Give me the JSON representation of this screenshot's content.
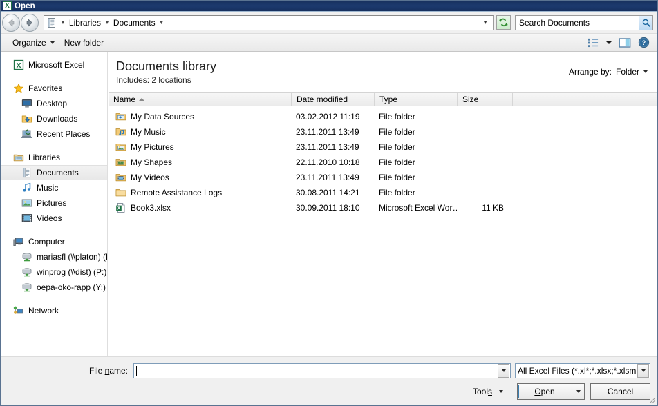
{
  "window": {
    "title": "Open",
    "icon": "excel-icon"
  },
  "navigation": {
    "back_label": "Back",
    "forward_label": "Forward",
    "address": {
      "icon": "library-document-icon",
      "crumbs": [
        "Libraries",
        "Documents"
      ],
      "dropdown_icon": "chevron-down-icon"
    },
    "refresh_icon": "refresh-icon",
    "search": {
      "placeholder": "Search Documents",
      "value": "",
      "icon": "search-icon"
    }
  },
  "toolbar": {
    "organize_label": "Organize",
    "new_folder_label": "New folder",
    "views_icon": "list-view-icon",
    "views_caret_icon": "chevron-down-icon",
    "preview_pane_icon": "preview-pane-icon",
    "help_icon": "help-icon"
  },
  "sidebar": {
    "items": [
      {
        "label": "Microsoft Excel",
        "icon": "excel-icon",
        "level": 0,
        "selected": false,
        "gap_after": true
      },
      {
        "label": "Favorites",
        "icon": "star-icon",
        "level": 0,
        "selected": false
      },
      {
        "label": "Desktop",
        "icon": "desktop-icon",
        "level": 1,
        "selected": false
      },
      {
        "label": "Downloads",
        "icon": "downloads-folder-icon",
        "level": 1,
        "selected": false
      },
      {
        "label": "Recent Places",
        "icon": "recent-places-icon",
        "level": 1,
        "selected": false,
        "gap_after": true
      },
      {
        "label": "Libraries",
        "icon": "libraries-icon",
        "level": 0,
        "selected": false
      },
      {
        "label": "Documents",
        "icon": "documents-library-icon",
        "level": 1,
        "selected": true
      },
      {
        "label": "Music",
        "icon": "music-library-icon",
        "level": 1,
        "selected": false
      },
      {
        "label": "Pictures",
        "icon": "pictures-library-icon",
        "level": 1,
        "selected": false
      },
      {
        "label": "Videos",
        "icon": "videos-library-icon",
        "level": 1,
        "selected": false,
        "gap_after": true
      },
      {
        "label": "Computer",
        "icon": "computer-icon",
        "level": 0,
        "selected": false
      },
      {
        "label": "mariasfl (\\\\platon) (M:)",
        "icon": "network-drive-icon",
        "level": 1,
        "selected": false
      },
      {
        "label": "winprog (\\\\dist) (P:)",
        "icon": "network-drive-icon",
        "level": 1,
        "selected": false
      },
      {
        "label": "oepa-oko-rapp (Y:)",
        "icon": "network-drive-icon",
        "level": 1,
        "selected": false,
        "gap_after": true
      },
      {
        "label": "Network",
        "icon": "network-icon",
        "level": 0,
        "selected": false
      }
    ]
  },
  "main": {
    "library_title": "Documents library",
    "library_subtitle": "Includes:  2 locations",
    "arrange_by_label": "Arrange by:",
    "arrange_by_value": "Folder",
    "arrange_caret_icon": "chevron-down-icon",
    "columns": [
      {
        "label": "Name",
        "sorted": "asc"
      },
      {
        "label": "Date modified",
        "sorted": ""
      },
      {
        "label": "Type",
        "sorted": ""
      },
      {
        "label": "Size",
        "sorted": ""
      }
    ],
    "rows": [
      {
        "name": "My Data Sources",
        "date": "03.02.2012 11:19",
        "type": "File folder",
        "size": "",
        "icon": "data-sources-folder-icon"
      },
      {
        "name": "My Music",
        "date": "23.11.2011 13:49",
        "type": "File folder",
        "size": "",
        "icon": "music-folder-icon"
      },
      {
        "name": "My Pictures",
        "date": "23.11.2011 13:49",
        "type": "File folder",
        "size": "",
        "icon": "pictures-folder-icon"
      },
      {
        "name": "My Shapes",
        "date": "22.11.2010 10:18",
        "type": "File folder",
        "size": "",
        "icon": "shapes-folder-icon"
      },
      {
        "name": "My Videos",
        "date": "23.11.2011 13:49",
        "type": "File folder",
        "size": "",
        "icon": "videos-folder-icon"
      },
      {
        "name": "Remote Assistance Logs",
        "date": "30.08.2011 14:21",
        "type": "File folder",
        "size": "",
        "icon": "folder-icon"
      },
      {
        "name": "Book3.xlsx",
        "date": "30.09.2011 18:10",
        "type": "Microsoft Excel Wor…",
        "size": "11 KB",
        "icon": "excel-file-icon"
      }
    ]
  },
  "footer": {
    "file_name_label": "File name:",
    "file_name_value": "",
    "file_name_dropdown_icon": "chevron-down-icon",
    "file_type_value": "All Excel Files (*.xl*;*.xlsx;*.xlsm;",
    "file_type_dropdown_icon": "chevron-down-icon",
    "tools_label": "Tools",
    "tools_caret_icon": "chevron-down-icon",
    "open_label": "Open",
    "open_caret_icon": "chevron-down-icon",
    "cancel_label": "Cancel"
  },
  "colors": {
    "titlebar": "#17305e",
    "selection": "#e8e8e8",
    "excel_green": "#1e7145",
    "accent_blue": "#3c7fb1"
  }
}
